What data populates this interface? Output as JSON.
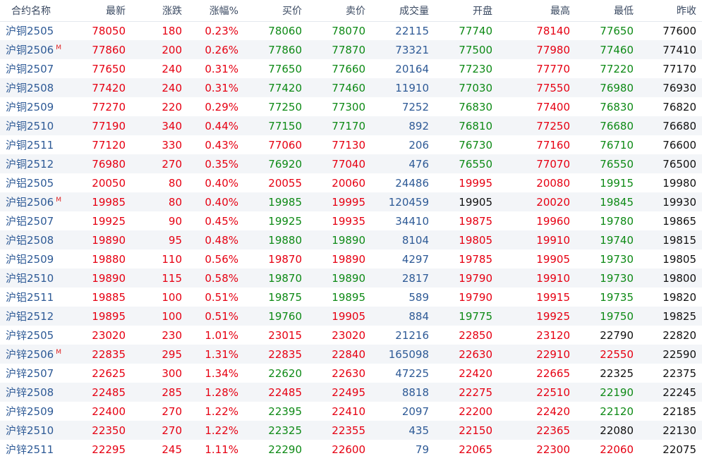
{
  "colors": {
    "up": "#e60012",
    "down": "#0e8a16",
    "neutral_volume": "#2e5a96",
    "flat": "#111111"
  },
  "headers": [
    "合约名称",
    "最新",
    "涨跌",
    "涨幅%",
    "买价",
    "卖价",
    "成交量",
    "开盘",
    "最高",
    "最低",
    "昨收"
  ],
  "rows": [
    {
      "name": "沪铜2505",
      "main": "",
      "last": "78050",
      "chg": "180",
      "pct": "0.23%",
      "bid": "78060",
      "ask": "78070",
      "vol": "22115",
      "open": "77740",
      "high": "78140",
      "low": "77650",
      "prev": "77600",
      "c_last": "red",
      "c_chg": "red",
      "c_pct": "red",
      "c_bid": "green",
      "c_ask": "green",
      "c_open": "green",
      "c_high": "red",
      "c_low": "green"
    },
    {
      "name": "沪铜2506",
      "main": "M",
      "last": "77860",
      "chg": "200",
      "pct": "0.26%",
      "bid": "77860",
      "ask": "77870",
      "vol": "73321",
      "open": "77500",
      "high": "77980",
      "low": "77460",
      "prev": "77410",
      "c_last": "red",
      "c_chg": "red",
      "c_pct": "red",
      "c_bid": "green",
      "c_ask": "green",
      "c_open": "green",
      "c_high": "red",
      "c_low": "green"
    },
    {
      "name": "沪铜2507",
      "main": "",
      "last": "77650",
      "chg": "240",
      "pct": "0.31%",
      "bid": "77650",
      "ask": "77660",
      "vol": "20164",
      "open": "77230",
      "high": "77770",
      "low": "77220",
      "prev": "77170",
      "c_last": "red",
      "c_chg": "red",
      "c_pct": "red",
      "c_bid": "green",
      "c_ask": "green",
      "c_open": "green",
      "c_high": "red",
      "c_low": "green"
    },
    {
      "name": "沪铜2508",
      "main": "",
      "last": "77420",
      "chg": "240",
      "pct": "0.31%",
      "bid": "77420",
      "ask": "77460",
      "vol": "11910",
      "open": "77030",
      "high": "77550",
      "low": "76980",
      "prev": "76930",
      "c_last": "red",
      "c_chg": "red",
      "c_pct": "red",
      "c_bid": "green",
      "c_ask": "green",
      "c_open": "green",
      "c_high": "red",
      "c_low": "green"
    },
    {
      "name": "沪铜2509",
      "main": "",
      "last": "77270",
      "chg": "220",
      "pct": "0.29%",
      "bid": "77250",
      "ask": "77300",
      "vol": "7252",
      "open": "76830",
      "high": "77400",
      "low": "76830",
      "prev": "76820",
      "c_last": "red",
      "c_chg": "red",
      "c_pct": "red",
      "c_bid": "green",
      "c_ask": "green",
      "c_open": "green",
      "c_high": "red",
      "c_low": "green"
    },
    {
      "name": "沪铜2510",
      "main": "",
      "last": "77190",
      "chg": "340",
      "pct": "0.44%",
      "bid": "77150",
      "ask": "77170",
      "vol": "892",
      "open": "76810",
      "high": "77250",
      "low": "76680",
      "prev": "76680",
      "c_last": "red",
      "c_chg": "red",
      "c_pct": "red",
      "c_bid": "green",
      "c_ask": "green",
      "c_open": "green",
      "c_high": "red",
      "c_low": "green"
    },
    {
      "name": "沪铜2511",
      "main": "",
      "last": "77120",
      "chg": "330",
      "pct": "0.43%",
      "bid": "77060",
      "ask": "77130",
      "vol": "206",
      "open": "76730",
      "high": "77160",
      "low": "76710",
      "prev": "76600",
      "c_last": "red",
      "c_chg": "red",
      "c_pct": "red",
      "c_bid": "red",
      "c_ask": "red",
      "c_open": "green",
      "c_high": "red",
      "c_low": "green"
    },
    {
      "name": "沪铜2512",
      "main": "",
      "last": "76980",
      "chg": "270",
      "pct": "0.35%",
      "bid": "76920",
      "ask": "77040",
      "vol": "476",
      "open": "76550",
      "high": "77070",
      "low": "76550",
      "prev": "76500",
      "c_last": "red",
      "c_chg": "red",
      "c_pct": "red",
      "c_bid": "green",
      "c_ask": "red",
      "c_open": "green",
      "c_high": "red",
      "c_low": "green"
    },
    {
      "name": "沪铝2505",
      "main": "",
      "last": "20050",
      "chg": "80",
      "pct": "0.40%",
      "bid": "20055",
      "ask": "20060",
      "vol": "24486",
      "open": "19995",
      "high": "20080",
      "low": "19915",
      "prev": "19980",
      "c_last": "red",
      "c_chg": "red",
      "c_pct": "red",
      "c_bid": "red",
      "c_ask": "red",
      "c_open": "red",
      "c_high": "red",
      "c_low": "green"
    },
    {
      "name": "沪铝2506",
      "main": "M",
      "last": "19985",
      "chg": "80",
      "pct": "0.40%",
      "bid": "19985",
      "ask": "19995",
      "vol": "120459",
      "open": "19905",
      "high": "20020",
      "low": "19845",
      "prev": "19930",
      "c_last": "red",
      "c_chg": "red",
      "c_pct": "red",
      "c_bid": "green",
      "c_ask": "red",
      "c_open": "black",
      "c_high": "red",
      "c_low": "green"
    },
    {
      "name": "沪铝2507",
      "main": "",
      "last": "19925",
      "chg": "90",
      "pct": "0.45%",
      "bid": "19925",
      "ask": "19935",
      "vol": "34410",
      "open": "19875",
      "high": "19960",
      "low": "19780",
      "prev": "19865",
      "c_last": "red",
      "c_chg": "red",
      "c_pct": "red",
      "c_bid": "green",
      "c_ask": "red",
      "c_open": "red",
      "c_high": "red",
      "c_low": "green"
    },
    {
      "name": "沪铝2508",
      "main": "",
      "last": "19890",
      "chg": "95",
      "pct": "0.48%",
      "bid": "19880",
      "ask": "19890",
      "vol": "8104",
      "open": "19805",
      "high": "19910",
      "low": "19740",
      "prev": "19815",
      "c_last": "red",
      "c_chg": "red",
      "c_pct": "red",
      "c_bid": "green",
      "c_ask": "green",
      "c_open": "red",
      "c_high": "red",
      "c_low": "green"
    },
    {
      "name": "沪铝2509",
      "main": "",
      "last": "19880",
      "chg": "110",
      "pct": "0.56%",
      "bid": "19870",
      "ask": "19890",
      "vol": "4297",
      "open": "19785",
      "high": "19905",
      "low": "19730",
      "prev": "19805",
      "c_last": "red",
      "c_chg": "red",
      "c_pct": "red",
      "c_bid": "red",
      "c_ask": "red",
      "c_open": "red",
      "c_high": "red",
      "c_low": "green"
    },
    {
      "name": "沪铝2510",
      "main": "",
      "last": "19890",
      "chg": "115",
      "pct": "0.58%",
      "bid": "19870",
      "ask": "19890",
      "vol": "2817",
      "open": "19790",
      "high": "19910",
      "low": "19730",
      "prev": "19800",
      "c_last": "red",
      "c_chg": "red",
      "c_pct": "red",
      "c_bid": "green",
      "c_ask": "green",
      "c_open": "red",
      "c_high": "red",
      "c_low": "green"
    },
    {
      "name": "沪铝2511",
      "main": "",
      "last": "19885",
      "chg": "100",
      "pct": "0.51%",
      "bid": "19875",
      "ask": "19895",
      "vol": "589",
      "open": "19790",
      "high": "19915",
      "low": "19735",
      "prev": "19820",
      "c_last": "red",
      "c_chg": "red",
      "c_pct": "red",
      "c_bid": "green",
      "c_ask": "green",
      "c_open": "red",
      "c_high": "red",
      "c_low": "green"
    },
    {
      "name": "沪铝2512",
      "main": "",
      "last": "19895",
      "chg": "100",
      "pct": "0.51%",
      "bid": "19760",
      "ask": "19905",
      "vol": "884",
      "open": "19775",
      "high": "19925",
      "low": "19750",
      "prev": "19825",
      "c_last": "red",
      "c_chg": "red",
      "c_pct": "red",
      "c_bid": "green",
      "c_ask": "red",
      "c_open": "green",
      "c_high": "red",
      "c_low": "green"
    },
    {
      "name": "沪锌2505",
      "main": "",
      "last": "23020",
      "chg": "230",
      "pct": "1.01%",
      "bid": "23015",
      "ask": "23020",
      "vol": "21216",
      "open": "22850",
      "high": "23120",
      "low": "22790",
      "prev": "22820",
      "c_last": "red",
      "c_chg": "red",
      "c_pct": "red",
      "c_bid": "red",
      "c_ask": "red",
      "c_open": "red",
      "c_high": "red",
      "c_low": "black"
    },
    {
      "name": "沪锌2506",
      "main": "M",
      "last": "22835",
      "chg": "295",
      "pct": "1.31%",
      "bid": "22835",
      "ask": "22840",
      "vol": "165098",
      "open": "22630",
      "high": "22910",
      "low": "22550",
      "prev": "22590",
      "c_last": "red",
      "c_chg": "red",
      "c_pct": "red",
      "c_bid": "red",
      "c_ask": "red",
      "c_open": "red",
      "c_high": "red",
      "c_low": "red"
    },
    {
      "name": "沪锌2507",
      "main": "",
      "last": "22625",
      "chg": "300",
      "pct": "1.34%",
      "bid": "22620",
      "ask": "22630",
      "vol": "47225",
      "open": "22420",
      "high": "22665",
      "low": "22325",
      "prev": "22375",
      "c_last": "red",
      "c_chg": "red",
      "c_pct": "red",
      "c_bid": "green",
      "c_ask": "red",
      "c_open": "red",
      "c_high": "red",
      "c_low": "black"
    },
    {
      "name": "沪锌2508",
      "main": "",
      "last": "22485",
      "chg": "285",
      "pct": "1.28%",
      "bid": "22485",
      "ask": "22495",
      "vol": "8818",
      "open": "22275",
      "high": "22510",
      "low": "22190",
      "prev": "22245",
      "c_last": "red",
      "c_chg": "red",
      "c_pct": "red",
      "c_bid": "red",
      "c_ask": "red",
      "c_open": "red",
      "c_high": "red",
      "c_low": "green"
    },
    {
      "name": "沪锌2509",
      "main": "",
      "last": "22400",
      "chg": "270",
      "pct": "1.22%",
      "bid": "22395",
      "ask": "22410",
      "vol": "2097",
      "open": "22200",
      "high": "22420",
      "low": "22120",
      "prev": "22185",
      "c_last": "red",
      "c_chg": "red",
      "c_pct": "red",
      "c_bid": "green",
      "c_ask": "red",
      "c_open": "red",
      "c_high": "red",
      "c_low": "green"
    },
    {
      "name": "沪锌2510",
      "main": "",
      "last": "22350",
      "chg": "270",
      "pct": "1.22%",
      "bid": "22325",
      "ask": "22355",
      "vol": "435",
      "open": "22150",
      "high": "22365",
      "low": "22080",
      "prev": "22130",
      "c_last": "red",
      "c_chg": "red",
      "c_pct": "red",
      "c_bid": "green",
      "c_ask": "red",
      "c_open": "red",
      "c_high": "red",
      "c_low": "black"
    },
    {
      "name": "沪锌2511",
      "main": "",
      "last": "22295",
      "chg": "245",
      "pct": "1.11%",
      "bid": "22290",
      "ask": "22600",
      "vol": "79",
      "open": "22065",
      "high": "22300",
      "low": "22060",
      "prev": "22075",
      "c_last": "red",
      "c_chg": "red",
      "c_pct": "red",
      "c_bid": "green",
      "c_ask": "red",
      "c_open": "red",
      "c_high": "red",
      "c_low": "red"
    }
  ]
}
